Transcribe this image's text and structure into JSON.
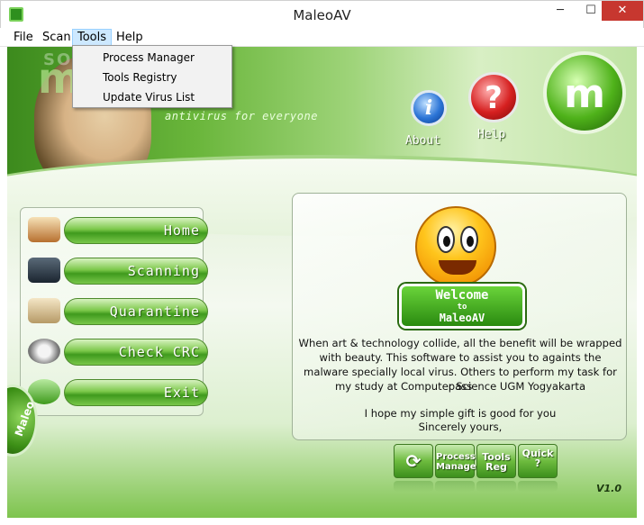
{
  "window": {
    "title": "MaleoAV",
    "min_label": "─",
    "max_label": "☐",
    "close_label": "✕"
  },
  "menubar": {
    "items": [
      "File",
      "Scan",
      "Tools",
      "Help"
    ],
    "active": "Tools"
  },
  "tools_menu": {
    "items": [
      "Process Manager",
      "Tools Registry",
      "Update Virus List"
    ]
  },
  "banner": {
    "slogan": "antivirus for everyone",
    "watermark": "SOFTPEDIA"
  },
  "top_buttons": {
    "about": "About",
    "help": "Help"
  },
  "nav": {
    "items": [
      "Home",
      "Scanning",
      "Quarantine",
      "Check CRC",
      "Exit"
    ]
  },
  "side_badge": "Maleo",
  "welcome": {
    "sign_line1": "Welcome",
    "sign_line2": "to",
    "sign_line3": "MaleoAV",
    "paragraph": [
      "When art & technology collide, all the benefit will be wrapped",
      "with beauty. This software to assist you to againts the",
      "malware specially local virus. Others to perform my task for pass",
      "my study at Computer Science UGM Yogyakarta"
    ],
    "closing": [
      "I hope my simple gift is good for you",
      "Sincerely yours,"
    ]
  },
  "quick_tools": [
    {
      "label": ""
    },
    {
      "label": "Process Manager"
    },
    {
      "label": "Tools Reg"
    },
    {
      "label": "Quick ?"
    }
  ],
  "version": "V1.0",
  "colors": {
    "accent_green": "#4fb21a",
    "close_red": "#c7372f",
    "menu_highlight": "#cde8ff"
  }
}
